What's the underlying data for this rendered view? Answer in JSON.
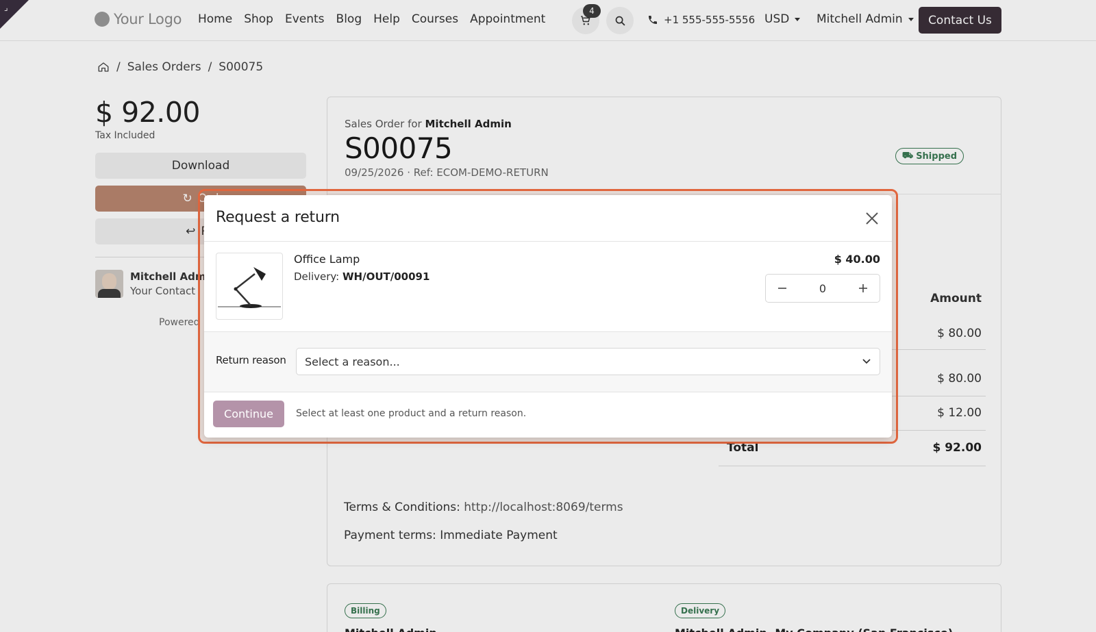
{
  "header": {
    "logo_text": "Your Logo",
    "nav": [
      "Home",
      "Shop",
      "Events",
      "Blog",
      "Help",
      "Courses",
      "Appointment"
    ],
    "cart_count": "4",
    "phone": "+1 555-555-5556",
    "currency": "USD",
    "user": "Mitchell Admin",
    "contact_button": "Contact Us"
  },
  "breadcrumb": {
    "home_icon": "home-icon",
    "separator": "/",
    "items": [
      "Sales Orders",
      "S00075"
    ]
  },
  "sidebar": {
    "amount": "$ 92.00",
    "tax_note": "Tax Included",
    "download": "Download",
    "order_again": "Ord",
    "return": "Re",
    "contact_name": "Mitchell Admin",
    "contact_role": "Your Contact",
    "powered": "Powered"
  },
  "order": {
    "for_label": "Sales Order for",
    "customer": "Mitchell Admin",
    "number": "S00075",
    "meta": "09/25/2026 · Ref: ECOM-DEMO-RETURN",
    "status": "Shipped",
    "amount_header": "Amount",
    "line_values": [
      "$ 80.00",
      "$ 80.00",
      "$ 12.00"
    ],
    "total_label": "Total",
    "total_value": "$ 92.00",
    "terms_label": "Terms & Conditions:",
    "terms_link": "http://localhost:8069/terms",
    "payment_terms": "Payment terms: Immediate Payment",
    "billing_label": "Billing",
    "delivery_label": "Delivery",
    "billing_name": "Mitchell Admin",
    "delivery_name": "Mitchell Admin, My Company (San Francisco)"
  },
  "modal": {
    "title": "Request a return",
    "product": {
      "name": "Office Lamp",
      "delivery_label": "Delivery:",
      "delivery_ref": "WH/OUT/00091",
      "price": "$ 40.00",
      "quantity": "0"
    },
    "reason_label": "Return reason",
    "reason_placeholder": "Select a reason...",
    "continue": "Continue",
    "hint": "Select at least one product and a return reason."
  },
  "colors": {
    "brand_dark": "#3b2f39",
    "highlight": "#e2673f",
    "continue_disabled": "#b493a9",
    "success": "#3a7a54"
  }
}
